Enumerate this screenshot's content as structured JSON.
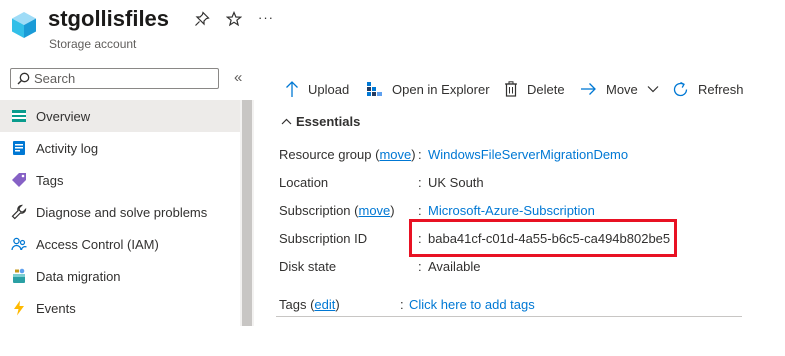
{
  "header": {
    "title": "stgollisfiles",
    "subtitle": "Storage account",
    "pin_icon": "pin-icon",
    "favorite_icon": "star-icon",
    "more_icon": "ellipsis-icon",
    "more_label": "···"
  },
  "search": {
    "placeholder": "Search",
    "collapse_label": "«"
  },
  "sidebar": {
    "items": [
      {
        "label": "Overview",
        "icon": "overview-icon"
      },
      {
        "label": "Activity log",
        "icon": "activity-log-icon"
      },
      {
        "label": "Tags",
        "icon": "tag-icon"
      },
      {
        "label": "Diagnose and solve problems",
        "icon": "wrench-icon"
      },
      {
        "label": "Access Control (IAM)",
        "icon": "people-icon"
      },
      {
        "label": "Data migration",
        "icon": "data-migration-icon"
      },
      {
        "label": "Events",
        "icon": "lightning-icon"
      }
    ]
  },
  "toolbar": {
    "upload": "Upload",
    "open_explorer": "Open in Explorer",
    "delete": "Delete",
    "move": "Move",
    "refresh": "Refresh"
  },
  "essentials": {
    "header": "Essentials",
    "resource_group_label": "Resource group (",
    "resource_group_move": "move",
    "resource_group_close": ")",
    "resource_group_value": "WindowsFileServerMigrationDemo",
    "location_label": "Location",
    "location_value": "UK South",
    "subscription_label": "Subscription (",
    "subscription_move": "move",
    "subscription_close": ")",
    "subscription_value": "Microsoft-Azure-Subscription",
    "subscription_id_label": "Subscription ID",
    "subscription_id_value": "baba41cf-c01d-4a55-b6c5-ca494b802be5",
    "disk_state_label": "Disk state",
    "disk_state_value": "Available",
    "tags_label": "Tags (",
    "tags_edit": "edit",
    "tags_close": ")",
    "tags_value": "Click here to add tags",
    "colon": ":"
  },
  "colors": {
    "accent": "#0078d4",
    "highlight": "#e81123",
    "active_bg": "#edebe9"
  }
}
